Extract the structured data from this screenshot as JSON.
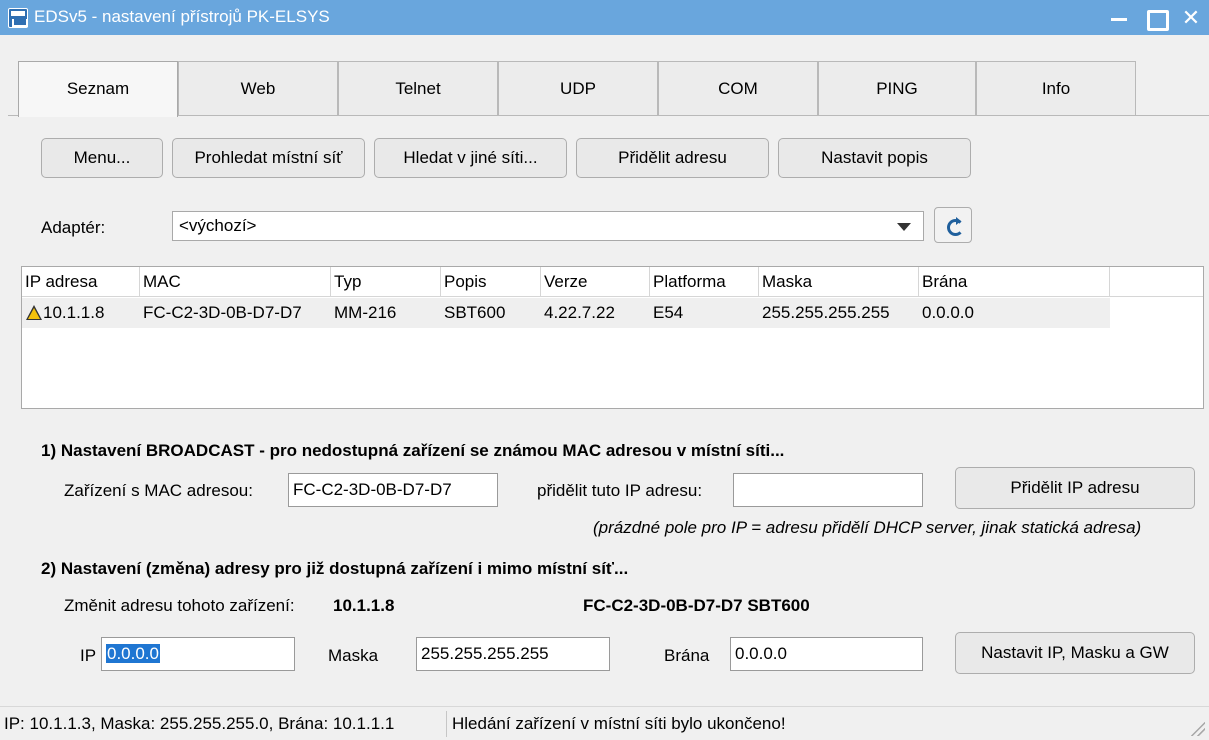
{
  "window": {
    "title": "EDSv5 - nastavení přístrojů PK-ELSYS"
  },
  "tabs": [
    "Seznam",
    "Web",
    "Telnet",
    "UDP",
    "COM",
    "PING",
    "Info"
  ],
  "toolbar": {
    "menu": "Menu...",
    "search_local": "Prohledat místní síť",
    "search_other": "Hledat v jiné síti...",
    "assign_address": "Přidělit adresu",
    "set_description": "Nastavit popis"
  },
  "adapter": {
    "label": "Adaptér:",
    "selected": "<výchozí>"
  },
  "table": {
    "columns": [
      "IP adresa",
      "MAC",
      "Typ",
      "Popis",
      "Verze",
      "Platforma",
      "Maska",
      "Brána"
    ],
    "rows": [
      [
        "10.1.1.8",
        "FC-C2-3D-0B-D7-D7",
        "MM-216",
        "SBT600",
        "4.22.7.22",
        "E54",
        "255.255.255.255",
        "0.0.0.0"
      ]
    ]
  },
  "broadcast": {
    "heading": "1) Nastavení BROADCAST - pro nedostupná zařízení se známou MAC adresou v místní síti...",
    "mac_label": "Zařízení s MAC adresou:",
    "mac_value": "FC-C2-3D-0B-D7-D7",
    "ip_label": "přidělit tuto IP adresu:",
    "ip_value": "",
    "assign_button": "Přidělit IP adresu",
    "hint": "(prázdné pole pro IP = adresu přidělí DHCP server, jinak statická adresa)"
  },
  "change": {
    "heading": "2) Nastavení (změna) adresy pro již dostupná zařízení i mimo místní síť...",
    "device_label": "Změnit adresu tohoto zařízení:",
    "device_ip": "10.1.1.8",
    "device_mac_desc": "FC-C2-3D-0B-D7-D7  SBT600",
    "ip_label": "IP",
    "ip_value": "0.0.0.0",
    "mask_label": "Maska",
    "mask_value": "255.255.255.255",
    "gateway_label": "Brána",
    "gateway_value": "0.0.0.0",
    "set_button": "Nastavit IP, Masku a GW"
  },
  "status": {
    "network": "IP: 10.1.1.3, Maska: 255.255.255.0, Brána: 10.1.1.1",
    "message": "Hledání zařízení v místní síti bylo ukončeno!"
  }
}
